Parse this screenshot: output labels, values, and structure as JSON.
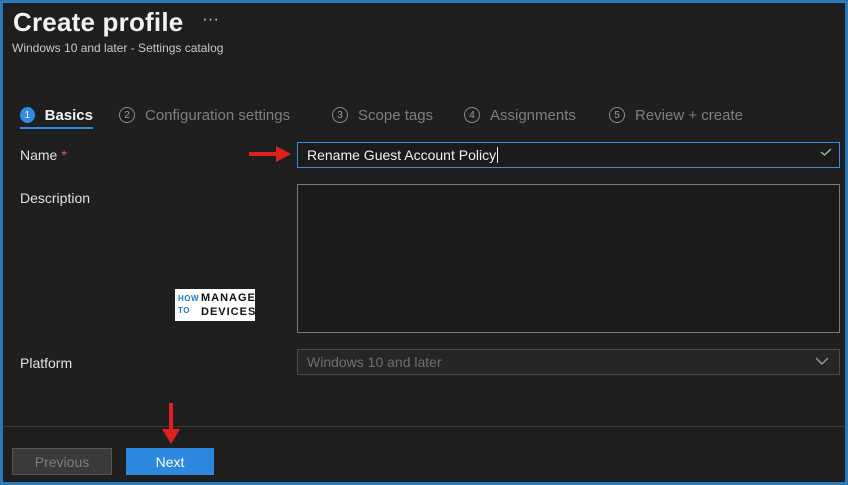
{
  "header": {
    "title": "Create profile",
    "more_label": "···",
    "subtitle": "Windows 10 and later - Settings catalog"
  },
  "tabs": [
    {
      "num": "1",
      "label": "Basics",
      "active": true
    },
    {
      "num": "2",
      "label": "Configuration settings",
      "active": false
    },
    {
      "num": "3",
      "label": "Scope tags",
      "active": false
    },
    {
      "num": "4",
      "label": "Assignments",
      "active": false
    },
    {
      "num": "5",
      "label": "Review + create",
      "active": false
    }
  ],
  "form": {
    "name_label": "Name",
    "required_marker": "*",
    "name_value": "Rename Guest Account Policy",
    "description_label": "Description",
    "description_value": "",
    "platform_label": "Platform",
    "platform_value": "Windows 10 and later"
  },
  "watermark": {
    "how": "HOW",
    "to": "TO",
    "manage": "MANAGE",
    "devices": "DEVICES"
  },
  "footer": {
    "previous_label": "Previous",
    "next_label": "Next"
  },
  "colors": {
    "accent": "#2f8ae0",
    "annotation_arrow": "#e02020",
    "background": "#1f1f1f",
    "frame": "#2a79b8"
  }
}
